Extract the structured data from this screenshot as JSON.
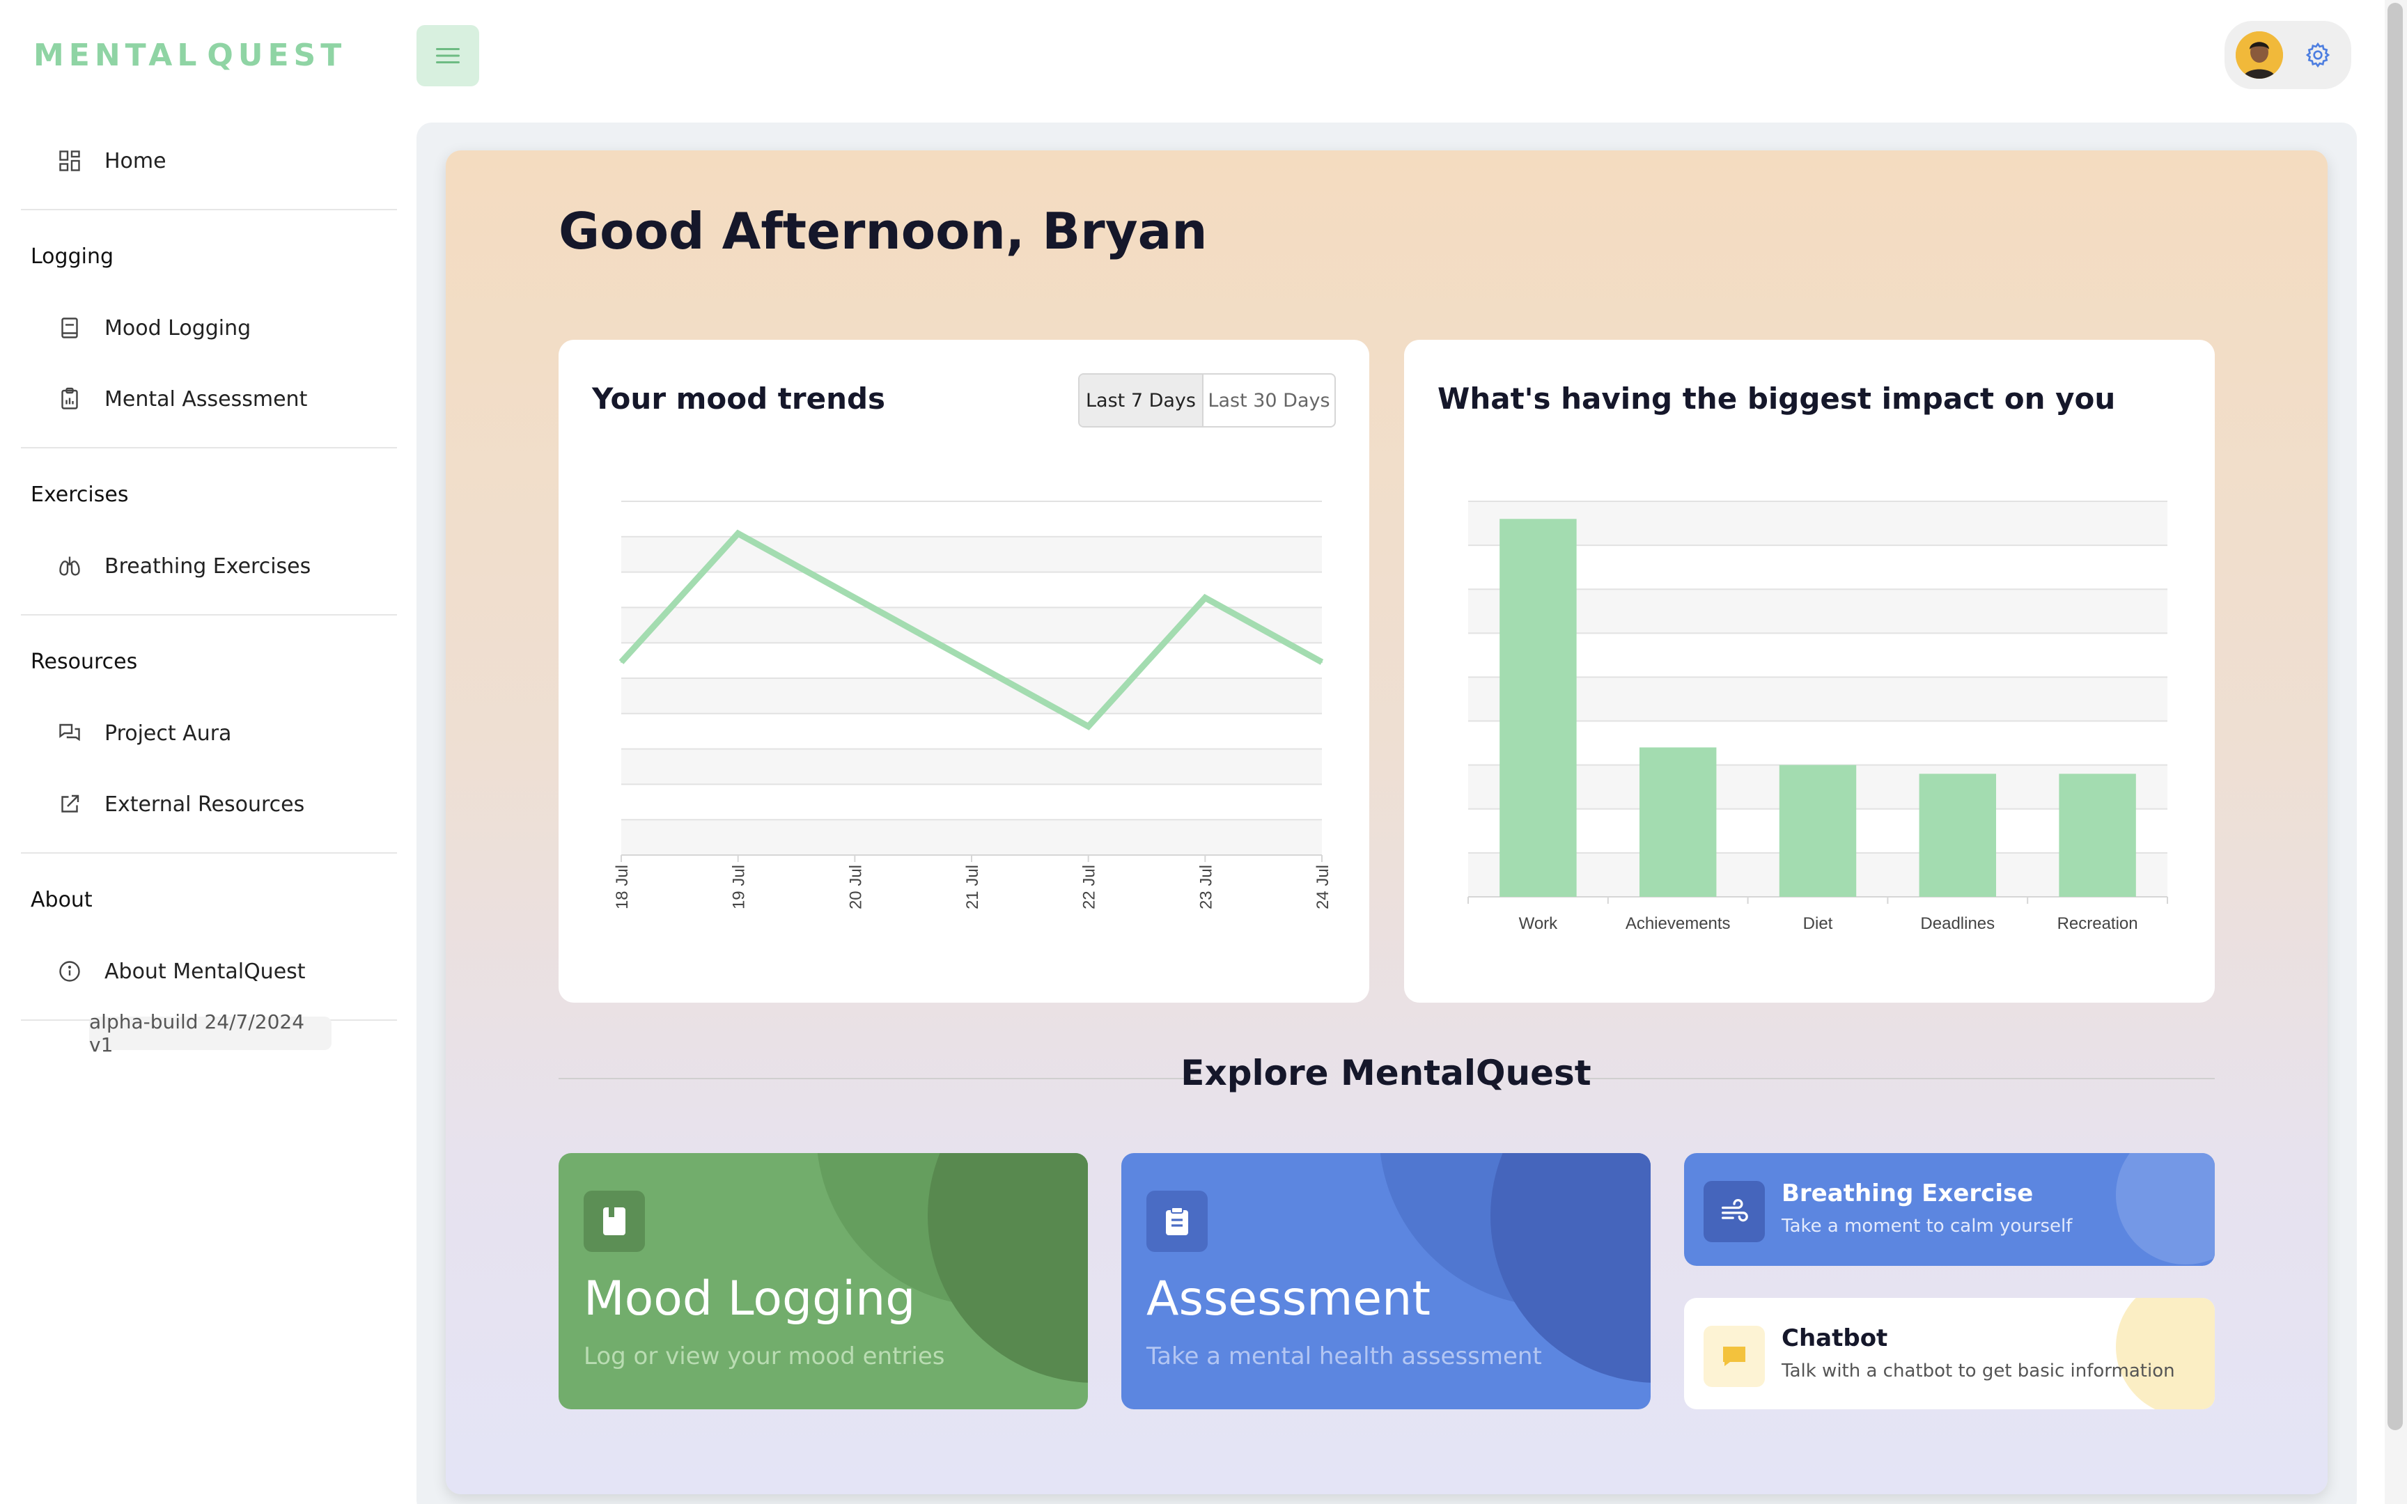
{
  "app": {
    "logo_left": "MENTAL",
    "logo_right": "QUEST"
  },
  "sidebar": {
    "home": "Home",
    "sections": [
      {
        "title": "Logging",
        "items": [
          "Mood Logging",
          "Mental Assessment"
        ]
      },
      {
        "title": "Exercises",
        "items": [
          "Breathing Exercises"
        ]
      },
      {
        "title": "Resources",
        "items": [
          "Project Aura",
          "External Resources"
        ]
      },
      {
        "title": "About",
        "items": [
          "About MentalQuest"
        ]
      }
    ],
    "build": "alpha-build 24/7/2024 v1"
  },
  "main": {
    "greeting": "Good Afternoon, Bryan",
    "mood_panel": {
      "title": "Your mood trends",
      "range_options": [
        "Last 7 Days",
        "Last 30 Days"
      ],
      "selected_range": "Last 7 Days"
    },
    "impact_panel": {
      "title": "What's having the biggest impact on you"
    },
    "explore": {
      "title": "Explore MentalQuest",
      "mood_tile": {
        "title": "Mood Logging",
        "subtitle": "Log or view your mood entries"
      },
      "assessment_tile": {
        "title": "Assessment",
        "subtitle": "Take a mental health assessment"
      },
      "breathing_tile": {
        "title": "Breathing Exercise",
        "subtitle": "Take a moment to calm yourself"
      },
      "chatbot_tile": {
        "title": "Chatbot",
        "subtitle": "Talk with a chatbot to get basic information"
      }
    }
  },
  "chart_data": [
    {
      "type": "line",
      "x": [
        "18 Jul",
        "19 Jul",
        "20 Jul",
        "21 Jul",
        "22 Jul",
        "23 Jul",
        "24 Jul"
      ],
      "values": [
        3,
        5,
        4,
        3,
        2,
        4,
        3
      ],
      "ylim": [
        0,
        5.5
      ],
      "grid": true,
      "color": "#a3dcb0"
    },
    {
      "type": "bar",
      "categories": [
        "Work",
        "Achievements",
        "Diet",
        "Deadlines",
        "Recreation"
      ],
      "values": [
        8.6,
        3.4,
        3.0,
        2.8,
        2.8
      ],
      "ylim": [
        0,
        9
      ],
      "grid": true,
      "color": "#a3dcb0"
    }
  ],
  "colors": {
    "accent_green": "#8fd4a4",
    "mood_tile": "#72ad6c",
    "assessment_tile": "#5c86e0",
    "breathing_tile": "#5c86e0"
  }
}
